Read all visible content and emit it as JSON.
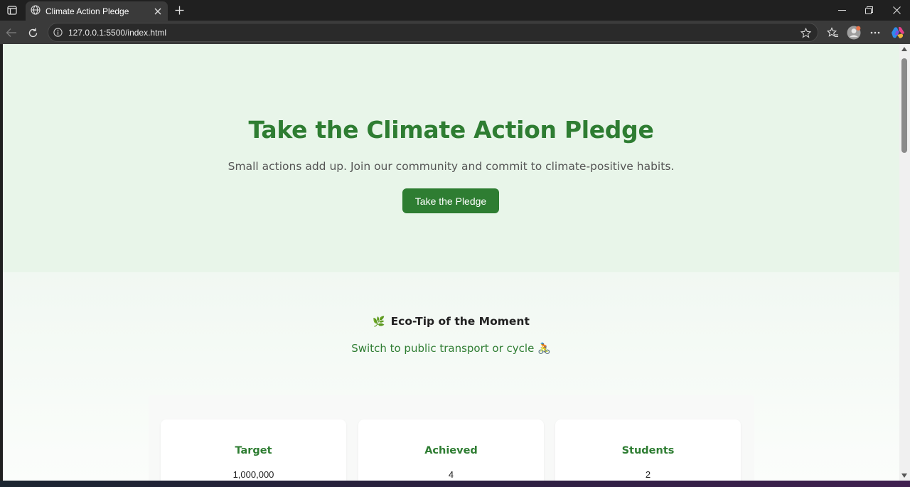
{
  "browser": {
    "tab_title": "Climate Action Pledge",
    "url": "127.0.0.1:5500/index.html"
  },
  "hero": {
    "title": "Take the Climate Action Pledge",
    "subtitle": "Small actions add up. Join our community and commit to climate-positive habits.",
    "button_label": "Take the Pledge"
  },
  "eco_tip": {
    "heading_icon": "🌿",
    "heading": "Eco-Tip of the Moment",
    "tip": "Switch to public transport or cycle 🚴"
  },
  "stats": [
    {
      "label": "Target",
      "value": "1,000,000"
    },
    {
      "label": "Achieved",
      "value": "4"
    },
    {
      "label": "Students",
      "value": "2"
    }
  ],
  "colors": {
    "accent": "#2e7d32",
    "hero_bg": "#e8f5e9",
    "tab_bar": "#202020",
    "toolbar": "#3a3a3a"
  }
}
